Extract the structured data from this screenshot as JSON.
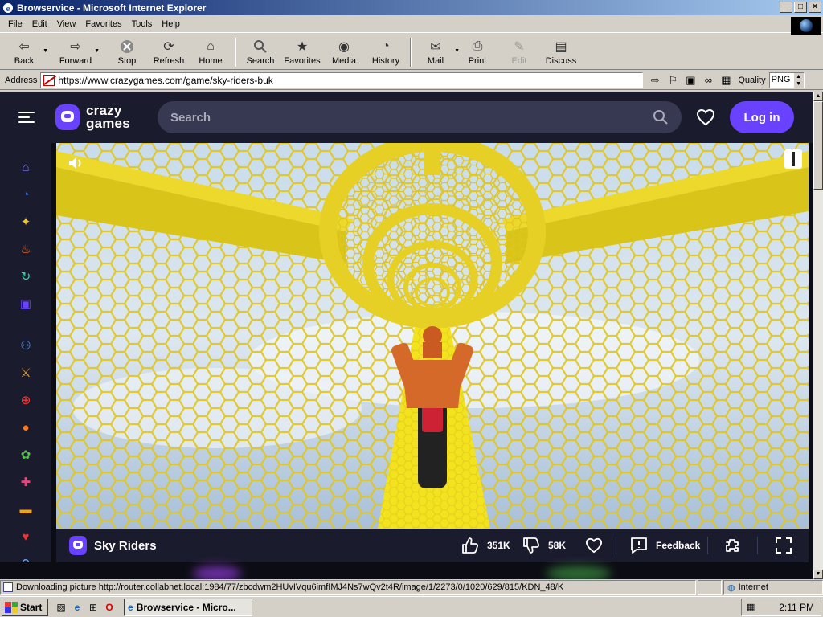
{
  "window": {
    "title": "Browservice - Microsoft Internet Explorer",
    "controls": {
      "minimize": "_",
      "maximize": "□",
      "close": "×"
    }
  },
  "menu": [
    "File",
    "Edit",
    "View",
    "Favorites",
    "Tools",
    "Help"
  ],
  "toolbar": [
    {
      "label": "Back",
      "icon": "back-arrow-icon",
      "dropdown": true
    },
    {
      "label": "Forward",
      "icon": "forward-arrow-icon",
      "dropdown": true
    },
    {
      "label": "Stop",
      "icon": "stop-icon"
    },
    {
      "label": "Refresh",
      "icon": "refresh-icon"
    },
    {
      "label": "Home",
      "icon": "home-icon"
    },
    {
      "label": "Search",
      "icon": "search-icon"
    },
    {
      "label": "Favorites",
      "icon": "favorites-icon"
    },
    {
      "label": "Media",
      "icon": "media-icon"
    },
    {
      "label": "History",
      "icon": "history-icon"
    },
    {
      "label": "Mail",
      "icon": "mail-icon",
      "dropdown": true
    },
    {
      "label": "Print",
      "icon": "print-icon"
    },
    {
      "label": "Edit",
      "icon": "edit-icon",
      "disabled": true
    },
    {
      "label": "Discuss",
      "icon": "discuss-icon"
    }
  ],
  "address": {
    "label": "Address",
    "url": "https://www.crazygames.com/game/sky-riders-buk",
    "quality_label": "Quality",
    "quality_value": "PNG"
  },
  "site": {
    "logo_line1": "crazy",
    "logo_line2": "games",
    "search_placeholder": "Search",
    "login_label": "Log in",
    "sidebar_icons": [
      "home-icon",
      "recent-icon",
      "new-icon",
      "trending-icon",
      "updated-icon",
      "originals-icon",
      "multiplayer-icon",
      "action-icon",
      "adventure-icon",
      "basketball-icon",
      "casual-icon",
      "clicker-icon",
      "driving-icon",
      "card-icon",
      "io-icon"
    ],
    "game": {
      "title": "Sky Riders",
      "likes": "351K",
      "dislikes": "58K",
      "feedback_label": "Feedback"
    }
  },
  "status": {
    "text": "Downloading picture http://router.collabnet.local:1984/77/zbcdwm2HUvIVqu6imfIMJ4Ns7wQv2t4R/image/1/2273/0/1020/629/815/KDN_48/K",
    "zone": "Internet"
  },
  "taskbar": {
    "start": "Start",
    "task": "Browservice - Micro...",
    "clock": "2:11 PM"
  }
}
